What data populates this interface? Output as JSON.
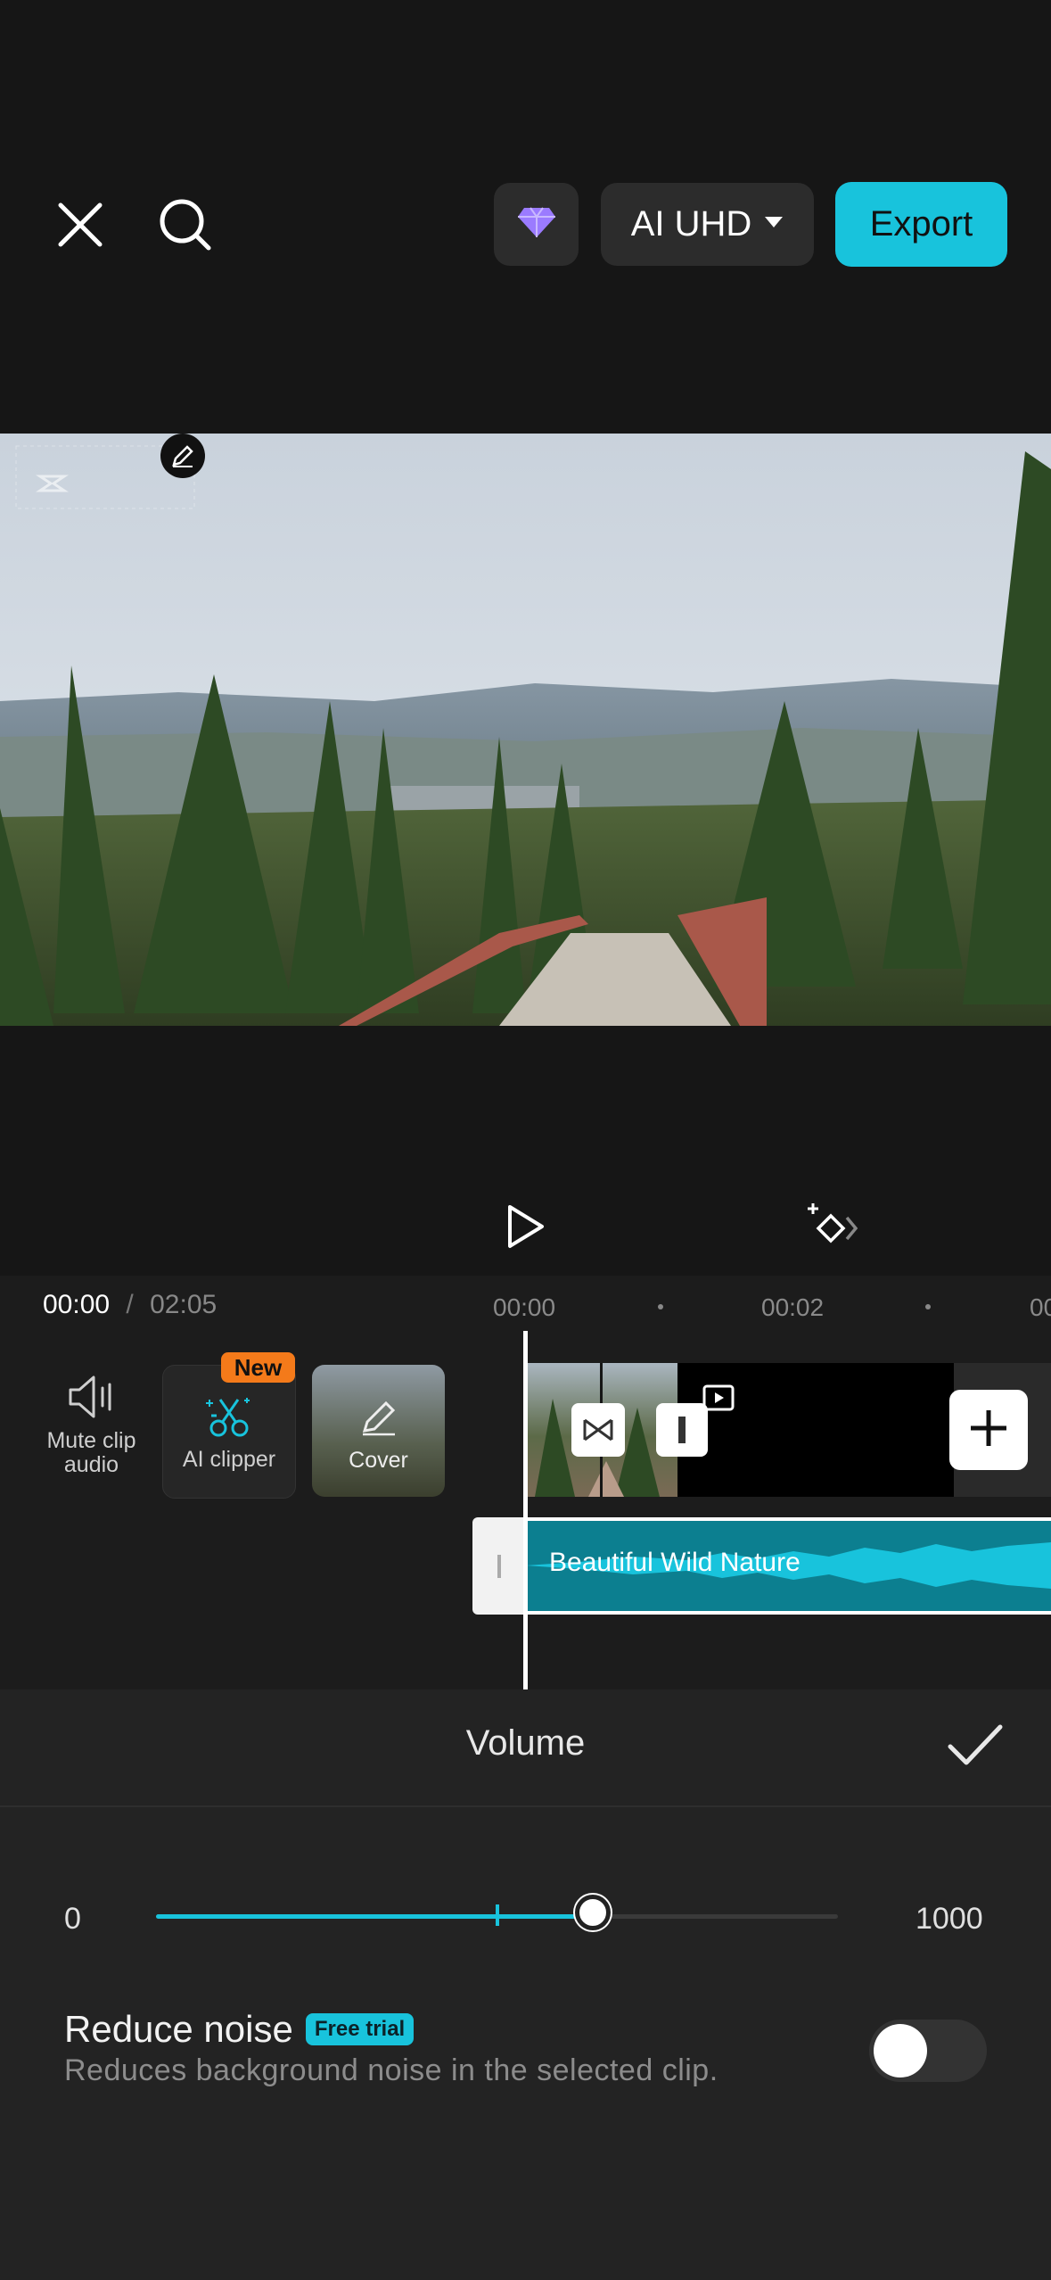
{
  "topbar": {
    "close_icon": "close-icon",
    "search_icon": "search-icon",
    "premium_icon": "diamond-icon",
    "resolution_label": "AI UHD",
    "export_label": "Export",
    "accent_color": "#18c3dc"
  },
  "preview": {
    "edit_icon": "pencil-icon",
    "watermark_icon": "capcut-logo"
  },
  "controls": {
    "play_icon": "play-icon",
    "keyframe_icon": "keyframe-icon"
  },
  "timeline": {
    "current_time": "00:00",
    "separator": "/",
    "total_time": "02:05",
    "ruler_labels": [
      "00:00",
      "00:02",
      "00"
    ],
    "tools": {
      "mute_label_line1": "Mute clip",
      "mute_label_line2": "audio",
      "ai_clipper_label": "AI clipper",
      "new_badge": "New",
      "cover_label": "Cover"
    },
    "audio_clip_name": "Beautiful Wild Nature"
  },
  "volume_panel": {
    "title": "Volume",
    "min_label": "0",
    "max_label": "1000",
    "value_fraction": 0.64,
    "default_marker_fraction": 0.5,
    "reduce_noise": {
      "title": "Reduce noise",
      "badge": "Free trial",
      "description": "Reduces background noise in the selected clip.",
      "enabled": false
    }
  }
}
